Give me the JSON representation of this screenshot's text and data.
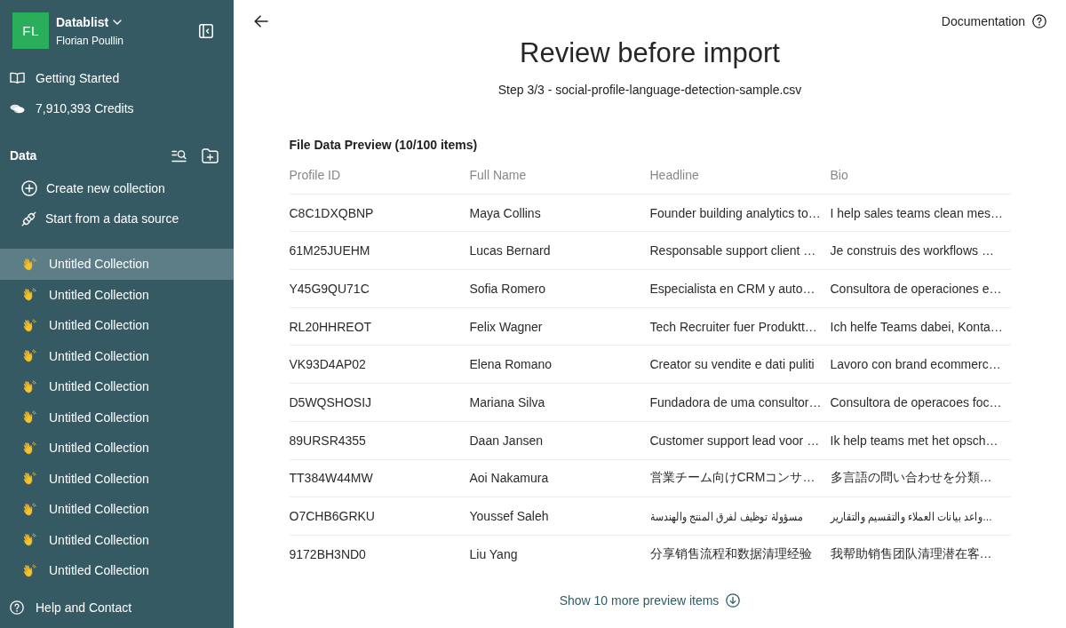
{
  "sidebar": {
    "workspace": {
      "initials": "FL",
      "name": "Datablist",
      "user": "Florian Poullin"
    },
    "links": [
      {
        "kind": "guide",
        "label": "Getting Started"
      },
      {
        "kind": "credits",
        "label": "7,910,393 Credits"
      }
    ],
    "data_section": {
      "title": "Data",
      "actions": [
        {
          "kind": "create",
          "label": "Create new collection"
        },
        {
          "kind": "source",
          "label": "Start from a data source"
        }
      ]
    },
    "collections": [
      {
        "label": "Untitled Collection",
        "selected": true
      },
      {
        "label": "Untitled Collection",
        "selected": false
      },
      {
        "label": "Untitled Collection",
        "selected": false
      },
      {
        "label": "Untitled Collection",
        "selected": false
      },
      {
        "label": "Untitled Collection",
        "selected": false
      },
      {
        "label": "Untitled Collection",
        "selected": false
      },
      {
        "label": "Untitled Collection",
        "selected": false
      },
      {
        "label": "Untitled Collection",
        "selected": false
      },
      {
        "label": "Untitled Collection",
        "selected": false
      },
      {
        "label": "Untitled Collection",
        "selected": false
      },
      {
        "label": "Untitled Collection",
        "selected": false
      }
    ],
    "help": {
      "label": "Help and Contact"
    }
  },
  "header": {
    "documentation": "Documentation"
  },
  "page": {
    "title": "Review before import",
    "subtitle": "Step 3/3 - social-profile-language-detection-sample.csv"
  },
  "preview": {
    "caption": "File Data Preview (10/100 items)",
    "table": {
      "columns": [
        "Profile ID",
        "Full Name",
        "Headline",
        "Bio"
      ],
      "rows": [
        [
          "C8C1DXQBNP",
          "Maya Collins",
          "Founder building analytics to…",
          "I help sales teams clean mes…"
        ],
        [
          "61M25JUEHM",
          "Lucas Bernard",
          "Responsable support client …",
          "Je construis des workflows …"
        ],
        [
          "Y45G9QU71C",
          "Sofia Romero",
          "Especialista en CRM y auto…",
          "Consultora de operaciones e…"
        ],
        [
          "RL20HHREOT",
          "Felix Wagner",
          "Tech Recruiter fuer Produktt…",
          "Ich helfe Teams dabei, Konta…"
        ],
        [
          "VK93D4AP02",
          "Elena Romano",
          "Creator su vendite e dati puliti",
          "Lavoro con brand ecommerc…"
        ],
        [
          "D5WQSHOSIJ",
          "Mariana Silva",
          "Fundadora de uma consultor…",
          "Consultora de operacoes foc…"
        ],
        [
          "89URSR4355",
          "Daan Jansen",
          "Customer support lead voor …",
          "Ik help teams met het opsch…"
        ],
        [
          "TT384W44MW",
          "Aoi Nakamura",
          "営業チーム向けCRMコンサ…",
          "多言語の問い合わせを分類…"
        ],
        [
          "O7CHB6GRKU",
          "Youssef Saleh",
          "مسؤولة توظيف لفرق المنتج والهندسة",
          "…واعد بيانات العملاء والتقسيم والتقارير"
        ],
        [
          "9172BH3ND0",
          "Liu Yang",
          "分享销售流程和数据清理经验",
          "我帮助销售团队清理潜在客…"
        ]
      ]
    },
    "show_more": "Show 10 more preview items"
  }
}
